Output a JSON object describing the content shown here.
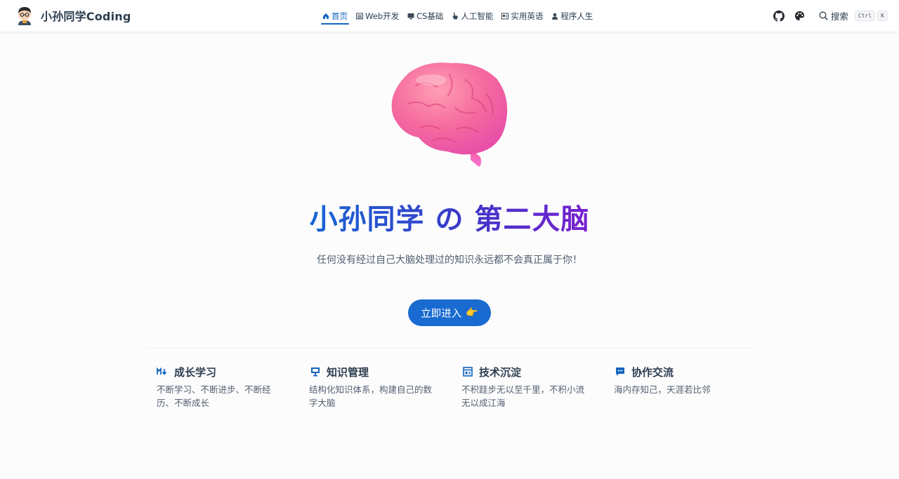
{
  "brand": {
    "name": "小孙同学Coding"
  },
  "nav": [
    {
      "label": "首页",
      "icon": "home-icon",
      "active": true
    },
    {
      "label": "Web开发",
      "icon": "list-icon",
      "active": false
    },
    {
      "label": "CS基础",
      "icon": "monitor-icon",
      "active": false
    },
    {
      "label": "人工智能",
      "icon": "hand-icon",
      "active": false
    },
    {
      "label": "实用英语",
      "icon": "book-icon",
      "active": false
    },
    {
      "label": "程序人生",
      "icon": "user-icon",
      "active": false
    }
  ],
  "search": {
    "label": "搜索",
    "key1": "Ctrl",
    "key2": "K"
  },
  "hero": {
    "title": "小孙同学 の 第二大脑",
    "tagline": "任何没有经过自己大脑处理过的知识永远都不会真正属于你！",
    "cta": "立即进入",
    "cta_emoji": "👉"
  },
  "features": [
    {
      "icon": "markdown-icon",
      "title": "成长学习",
      "desc": "不断学习、不断进步、不断经历、不断成长"
    },
    {
      "icon": "presentation-icon",
      "title": "知识管理",
      "desc": "结构化知识体系，构建自己的数字大脑"
    },
    {
      "icon": "layout-icon",
      "title": "技术沉淀",
      "desc": "不积跬步无以至千里，不积小流无以成江海"
    },
    {
      "icon": "chat-icon",
      "title": "协作交流",
      "desc": "海内存知己，天涯若比邻"
    }
  ],
  "colors": {
    "accent": "#1a6bd1",
    "title_gradient_start": "#1767d6",
    "title_gradient_end": "#7a1fd0"
  }
}
